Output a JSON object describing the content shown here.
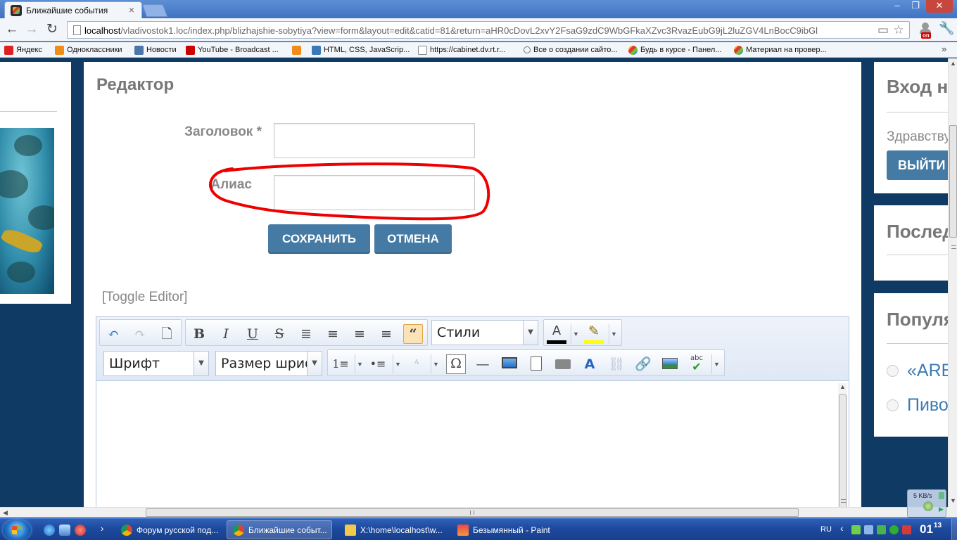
{
  "browser": {
    "tab_title": "Ближайшие события",
    "tab_close": "×",
    "window_controls": {
      "minimize": "–",
      "maximize": "❐",
      "close": "✕"
    },
    "nav": {
      "back": "←",
      "forward": "→",
      "reload": "↻"
    },
    "url_host": "localhost",
    "url_rest": "/vladivostok1.loc/index.php/blizhajshie-sobytiya?view=form&layout=edit&catid=81&return=aHR0cDovL2xvY2FsaG9zdC9WbGFkaXZvc3RvazEubG9jL2luZGV4LnBocC9ibGl",
    "star": "☆",
    "extension_badge": "on",
    "wrench": "🔧",
    "bookmarks": [
      {
        "label": "Яндекс",
        "icon": "yandex"
      },
      {
        "label": "Одноклассники",
        "icon": "ok"
      },
      {
        "label": "Новости",
        "icon": "vk"
      },
      {
        "label": "YouTube - Broadcast ...",
        "icon": "yt"
      },
      {
        "label": "",
        "icon": "ok"
      },
      {
        "label": "HTML, CSS, JavaScrip...",
        "icon": "html"
      },
      {
        "label": "https://cabinet.dv.rt.r...",
        "icon": "page"
      },
      {
        "label": "Все о создании сайто...",
        "icon": "pin"
      },
      {
        "label": "Будь в курсе - Панел...",
        "icon": "joomla"
      },
      {
        "label": "Материал на провер...",
        "icon": "joomla"
      }
    ],
    "bookmarks_more": "»"
  },
  "editor": {
    "heading": "Редактор",
    "title_label": "Заголовок *",
    "alias_label": "Алиас",
    "save_button": "СОХРАНИТЬ",
    "cancel_button": "ОТМЕНА",
    "toggle_editor": "[Toggle Editor]",
    "styles_select": "Стили",
    "font_select": "Шрифт",
    "size_select": "Размер шрифта",
    "toolbar_icons": {
      "undo": "↶",
      "redo": "↷",
      "new_document": "🗋",
      "bold": "B",
      "italic": "I",
      "underline": "U",
      "strikethrough": "S",
      "align_justify": "≣",
      "align_center": "≡",
      "align_left": "≡",
      "align_right": "≡",
      "blockquote": "“",
      "ordered_list": "1≡",
      "unordered_list": "•≡",
      "omega": "Ω",
      "hr": "—",
      "font_color_glyph": "A",
      "highlight_glyph": "✎",
      "styles_glyph": "A",
      "spellcheck_glyph": "abc"
    },
    "colors": {
      "font_color": "#000000",
      "highlight_color": "#ffff00",
      "accent": "#447aa4"
    }
  },
  "sidebar": {
    "login_title": "Вход на сайт",
    "greeting": "Здравствуйте",
    "logout_button": "ВЫЙТИ",
    "latest_title": "Последние",
    "popular_title": "Популярное",
    "popular_items": [
      "«ARE",
      "Пиво"
    ]
  },
  "net_speed": "5 KB/s",
  "taskbar": {
    "tasks": [
      {
        "label": "Форум русской под...",
        "icon": "chrome"
      },
      {
        "label": "Ближайшие событ...",
        "icon": "chrome"
      },
      {
        "label": "X:\\home\\localhost\\w...",
        "icon": "folder"
      },
      {
        "label": "Безымянный - Paint",
        "icon": "paint"
      }
    ],
    "more": "›",
    "language": "RU",
    "tray_arrow": "‹",
    "clock_hours": "01",
    "clock_minutes": "13"
  }
}
